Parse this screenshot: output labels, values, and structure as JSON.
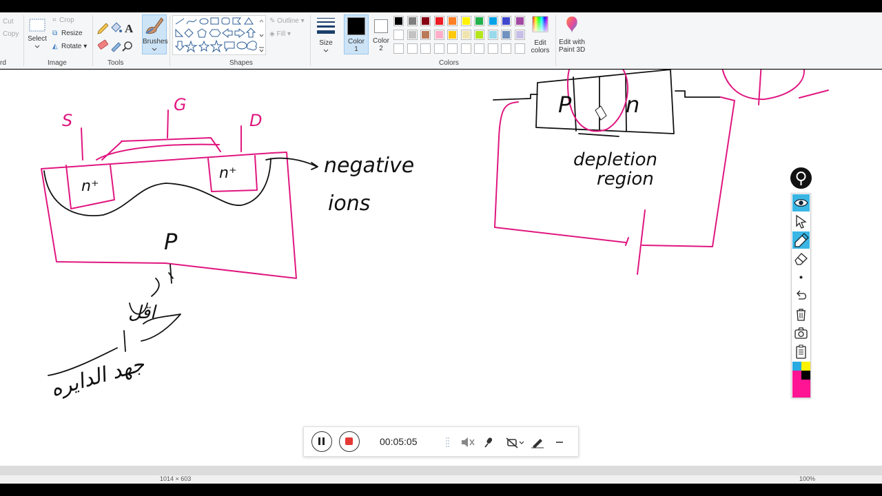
{
  "ribbon": {
    "clipboard": {
      "cut_label": "Cut",
      "copy_label": "Copy",
      "group_label": "rd"
    },
    "image": {
      "select_label": "Select",
      "crop_label": "Crop",
      "resize_label": "Resize",
      "rotate_label": "Rotate",
      "group_label": "Image"
    },
    "tools": {
      "group_label": "Tools"
    },
    "brushes": {
      "label": "Brushes"
    },
    "shapes": {
      "outline_label": "Outline",
      "fill_label": "Fill",
      "group_label": "Shapes"
    },
    "size": {
      "label": "Size"
    },
    "colors": {
      "color1_label": "Color",
      "color1_num": "1",
      "color2_label": "Color",
      "color2_num": "2",
      "edit_colors_line1": "Edit",
      "edit_colors_line2": "colors",
      "group_label": "Colors",
      "color1_value": "#000000",
      "color2_value": "#ffffff",
      "palette_row1": [
        "#000000",
        "#7f7f7f",
        "#880015",
        "#ed1c24",
        "#ff7f27",
        "#fff200",
        "#22b14c",
        "#00a2e8",
        "#3f48cc",
        "#a349a4"
      ],
      "palette_row2": [
        "#ffffff",
        "#c3c3c3",
        "#b97a57",
        "#ffaec9",
        "#ffc90e",
        "#efe4b0",
        "#b5e61d",
        "#99d9ea",
        "#7092be",
        "#c8bfe7"
      ],
      "palette_row3": [
        "#ffffff",
        "#ffffff",
        "#ffffff",
        "#ffffff",
        "#ffffff",
        "#ffffff",
        "#ffffff",
        "#ffffff",
        "#ffffff",
        "#ffffff"
      ]
    },
    "paint3d": {
      "line1": "Edit with",
      "line2": "Paint 3D"
    }
  },
  "drawing": {
    "ink_colors": {
      "pink": "#e0157f",
      "black": "#111111"
    },
    "mosfet": {
      "source_label": "S",
      "gate_label": "G",
      "drain_label": "D",
      "n_plus_left": "n⁺",
      "n_plus_right": "n⁺",
      "substrate_label": "P",
      "annotation_line1": "negative",
      "annotation_line2": "ions",
      "arabic_line1": "اقل",
      "arabic_line2": "جهد الدايره"
    },
    "diode": {
      "p_label": "P",
      "n_label": "n",
      "depletion_line1": "depletion",
      "depletion_line2": "region"
    }
  },
  "recorder": {
    "time": "00:05:05"
  },
  "side_toolbar": {
    "tools": [
      "eye-icon",
      "pointer-icon",
      "pen-icon",
      "eraser-icon",
      "dot-icon",
      "undo-icon",
      "trash-icon",
      "camera-icon",
      "clipboard-icon"
    ],
    "palette": [
      "#29abe2",
      "#fff200",
      "#ff1493",
      "#000000"
    ]
  },
  "status": {
    "dimensions": "1014 × 603",
    "zoom": "100%"
  }
}
